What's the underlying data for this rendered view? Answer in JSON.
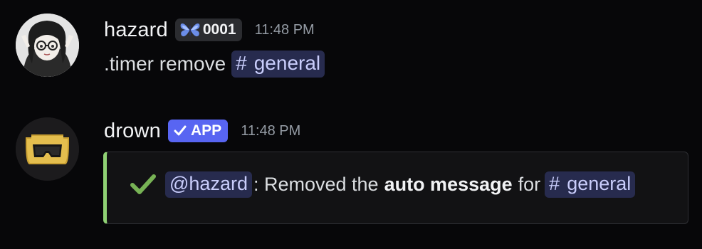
{
  "messages": [
    {
      "username": "hazard",
      "tag": "0001",
      "timestamp": "11:48 PM",
      "content_text": ".timer remove",
      "channel_mention": "general"
    },
    {
      "username": "drown",
      "app_badge": "APP",
      "timestamp": "11:48 PM",
      "embed": {
        "accent_color": "#8fd174",
        "user_mention": "@hazard",
        "text_before": ": Removed the",
        "bold_text": "auto message",
        "text_after": "for",
        "channel_mention": "general"
      }
    }
  ],
  "icons": {
    "hash": "#",
    "tag_icon": "butterfly-icon",
    "app_check": "checkmark-icon",
    "embed_check": "green-check-icon"
  },
  "colors": {
    "background": "#070709",
    "mention_bg": "#272b4e",
    "mention_text": "#c9cdfb",
    "app_badge": "#5865f2",
    "embed_accent": "#8fd174"
  }
}
